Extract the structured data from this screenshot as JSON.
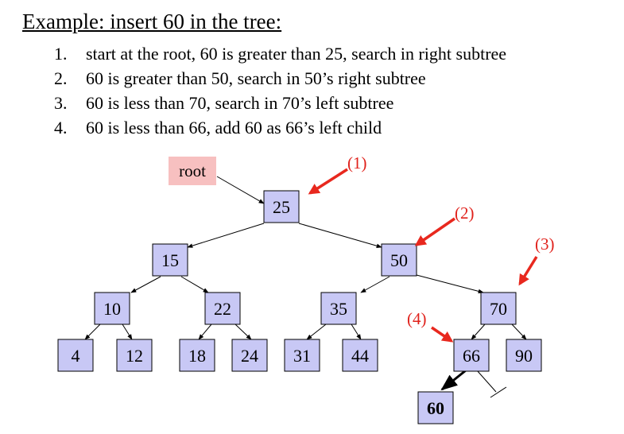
{
  "heading": "Example: insert 60 in the tree:",
  "steps": [
    {
      "num": "1.",
      "text": "start at the root, 60 is greater than 25, search in right subtree"
    },
    {
      "num": "2.",
      "text": "60 is greater than 50, search in 50’s right subtree"
    },
    {
      "num": "3.",
      "text": "60 is less than 70, search in 70’s left subtree"
    },
    {
      "num": "4.",
      "text": "60 is less than 66, add 60 as 66’s left child"
    }
  ],
  "root_label": "root",
  "nodes": {
    "n25": "25",
    "n15": "15",
    "n50": "50",
    "n10": "10",
    "n22": "22",
    "n35": "35",
    "n70": "70",
    "n4": "4",
    "n12": "12",
    "n18": "18",
    "n24": "24",
    "n31": "31",
    "n44": "44",
    "n66": "66",
    "n90": "90",
    "n60": "60"
  },
  "step_labels": [
    "(1)",
    "(2)",
    "(3)",
    "(4)"
  ],
  "colors": {
    "node_fill": "#c8c8f5",
    "root_label_fill": "#f7c0c0",
    "step_label": "#e0221c",
    "pointer_arrow": "#e8281e"
  }
}
